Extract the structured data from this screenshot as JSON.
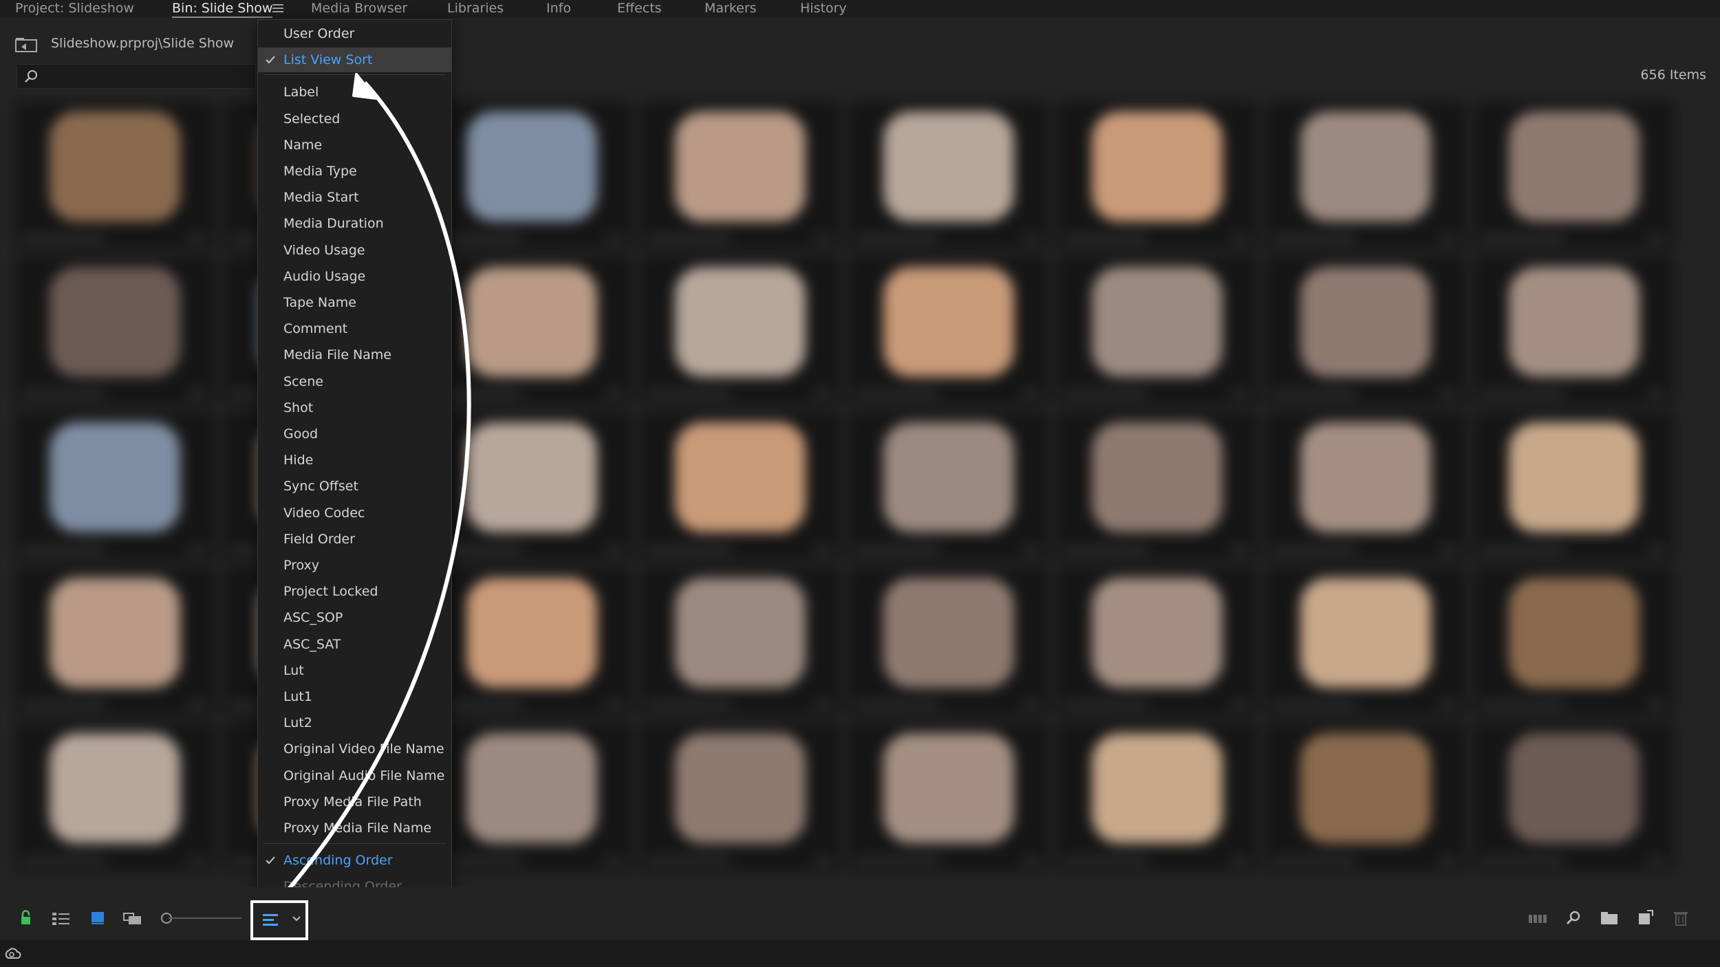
{
  "tabs": [
    {
      "label": "Project: Slideshow"
    },
    {
      "label": "Bin: Slide Show"
    },
    {
      "label": "Media Browser"
    },
    {
      "label": "Libraries"
    },
    {
      "label": "Info"
    },
    {
      "label": "Effects"
    },
    {
      "label": "Markers"
    },
    {
      "label": "History"
    }
  ],
  "header": {
    "breadcrumb": "Slideshow.prproj\\Slide Show",
    "items_count": "656 Items",
    "search_placeholder": ""
  },
  "sort_menu": {
    "top_items": [
      {
        "label": "User Order",
        "checked": false
      },
      {
        "label": "List View Sort",
        "checked": true
      }
    ],
    "columns": [
      "Label",
      "Selected",
      "Name",
      "Media Type",
      "Media Start",
      "Media Duration",
      "Video Usage",
      "Audio Usage",
      "Tape Name",
      "Comment",
      "Media File Name",
      "Scene",
      "Shot",
      "Good",
      "Hide",
      "Sync Offset",
      "Video Codec",
      "Field Order",
      "Proxy",
      "Project Locked",
      "ASC_SOP",
      "ASC_SAT",
      "Lut",
      "Lut1",
      "Lut2",
      "Original Video File Name",
      "Original Audio File Name",
      "Proxy Media File Path",
      "Proxy Media File Name"
    ],
    "order_items": [
      {
        "label": "Ascending Order",
        "checked": true,
        "enabled": true
      },
      {
        "label": "Descending Order",
        "checked": false,
        "enabled": false
      }
    ]
  },
  "colors": {
    "accent_blue": "#4aa3ff",
    "lock_green": "#3fbf5a",
    "annotation": "#ffffff"
  },
  "toolbar": {
    "icons": [
      "lock-icon",
      "list-view-icon",
      "icon-view-icon",
      "freeform-view-icon",
      "zoom-slider",
      "sort-icons-button",
      "automate-to-sequence-icon",
      "find-icon",
      "new-bin-icon",
      "new-item-icon",
      "trash-icon"
    ]
  }
}
